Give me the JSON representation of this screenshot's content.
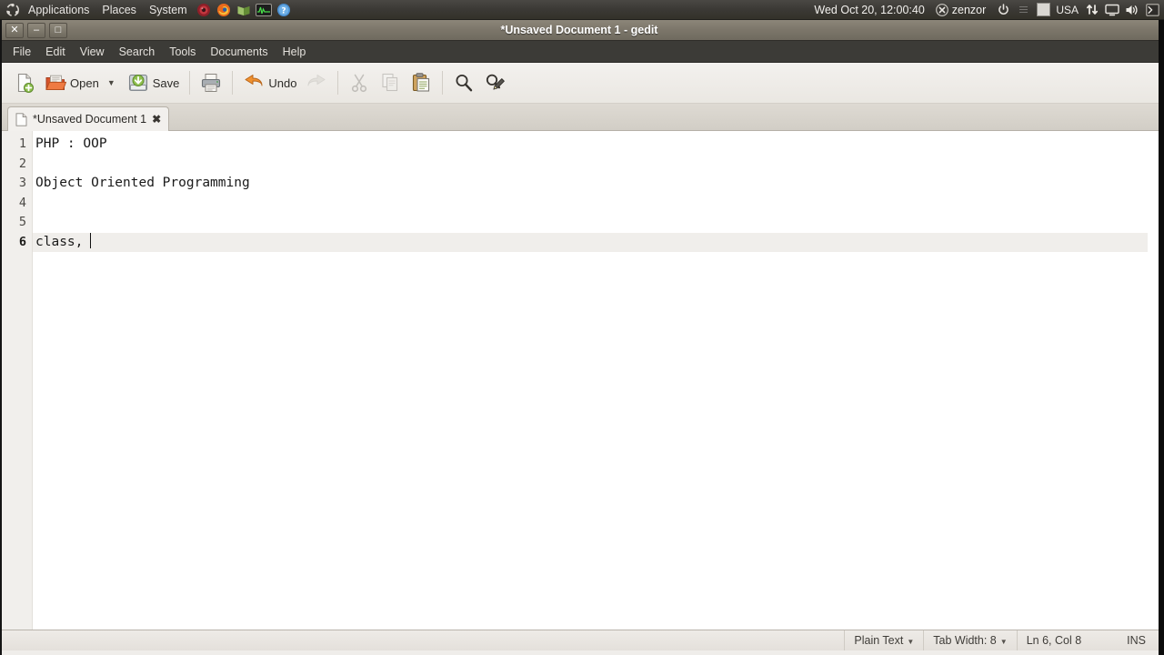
{
  "panel": {
    "logo_icon": "ubuntu-logo-icon",
    "menus": [
      {
        "label": "Applications",
        "name": "panel-menu-applications"
      },
      {
        "label": "Places",
        "name": "panel-menu-places"
      },
      {
        "label": "System",
        "name": "panel-menu-system"
      }
    ],
    "launchers": [
      {
        "name": "ubuntu-help-circle-icon"
      },
      {
        "name": "firefox-icon"
      },
      {
        "name": "green-book-icon"
      },
      {
        "name": "system-monitor-icon"
      },
      {
        "name": "help-question-icon"
      }
    ],
    "clock": "Wed Oct 20, 12:00:40",
    "user": "zenzor",
    "tray": [
      {
        "name": "power-icon"
      },
      {
        "name": "separator-dots-icon"
      },
      {
        "name": "keyboard-flag-icon"
      },
      {
        "name": "keyboard-layout-label",
        "label": "USA"
      },
      {
        "name": "network-updown-icon"
      },
      {
        "name": "display-icon"
      },
      {
        "name": "volume-icon"
      },
      {
        "name": "terminal-icon"
      }
    ]
  },
  "window": {
    "title": "*Unsaved Document 1 - gedit",
    "controls": {
      "close": "✕",
      "minimize": "–",
      "maximize": "□"
    }
  },
  "menubar": {
    "items": [
      {
        "label": "File",
        "name": "menu-file"
      },
      {
        "label": "Edit",
        "name": "menu-edit"
      },
      {
        "label": "View",
        "name": "menu-view"
      },
      {
        "label": "Search",
        "name": "menu-search"
      },
      {
        "label": "Tools",
        "name": "menu-tools"
      },
      {
        "label": "Documents",
        "name": "menu-documents"
      },
      {
        "label": "Help",
        "name": "menu-help"
      }
    ]
  },
  "toolbar": {
    "new_icon": "new-document-icon",
    "open_label": "Open",
    "open_icon": "open-folder-icon",
    "open_dropdown": "▼",
    "save_label": "Save",
    "save_icon": "save-icon",
    "print_icon": "print-icon",
    "undo_label": "Undo",
    "undo_icon": "undo-arrow-icon",
    "redo_icon": "redo-arrow-icon",
    "cut_icon": "cut-scissors-icon",
    "copy_icon": "copy-icon",
    "paste_icon": "paste-clipboard-icon",
    "find_icon": "find-magnifier-icon",
    "replace_icon": "replace-magnifier-icon"
  },
  "tab": {
    "icon": "document-icon",
    "title": "*Unsaved Document 1",
    "close": "✖"
  },
  "editor": {
    "lines": [
      {
        "num": "1",
        "text": "PHP : OOP",
        "current": false
      },
      {
        "num": "2",
        "text": "",
        "current": false
      },
      {
        "num": "3",
        "text": "Object Oriented Programming",
        "current": false
      },
      {
        "num": "4",
        "text": "",
        "current": false
      },
      {
        "num": "5",
        "text": "",
        "current": false
      },
      {
        "num": "6",
        "text": "class, ",
        "current": true
      }
    ]
  },
  "statusbar": {
    "language": "Plain Text",
    "language_arrow": "▼",
    "tab_width": "Tab Width: 8",
    "tab_width_arrow": "▼",
    "position": "Ln 6, Col 8",
    "insert_mode": "INS"
  }
}
